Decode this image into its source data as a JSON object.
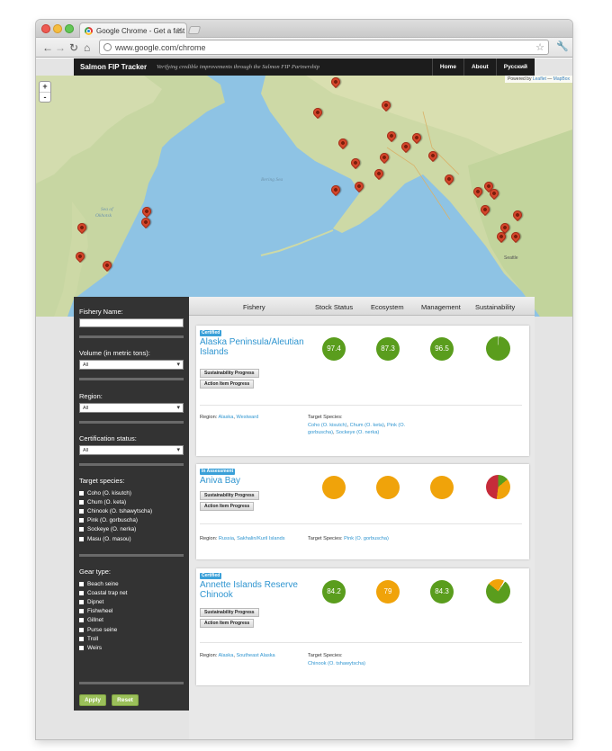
{
  "browser": {
    "tab_title": "Google Chrome - Get a fast",
    "url": "www.google.com/chrome"
  },
  "site": {
    "brand": "Salmon FIP Tracker",
    "tagline": "Verifying credible improvements through the Salmon FIP Partnership",
    "nav": [
      "Home",
      "About",
      "Русский"
    ]
  },
  "map": {
    "labels": {
      "bering_sea": "Bering Sea",
      "sea_okhotsk_1": "Sea of",
      "sea_okhotsk_2": "Okhotsk",
      "seattle": "Seattle"
    },
    "zoom_in": "+",
    "zoom_out": "-",
    "attribution_prefix": "Powered by",
    "attribution_leaflet": "Leaflet",
    "attribution_sep": "—",
    "attribution_mapbox": "MapBox"
  },
  "sidebar": {
    "fishery_name_label": "Fishery Name:",
    "volume_label": "Volume (in metric tons):",
    "volume_value": "All",
    "region_label": "Region:",
    "region_value": "All",
    "cert_label": "Certification status:",
    "cert_value": "All",
    "species_label": "Target species:",
    "species": [
      "Coho (O. kisutch)",
      "Chum (O. keta)",
      "Chinook (O. tshawytscha)",
      "Pink (O. gorbuscha)",
      "Sockeye (O. nerka)",
      "Masu (O. masou)"
    ],
    "gear_label": "Gear type:",
    "gear": [
      "Beach seine",
      "Coastal trap net",
      "Dipnet",
      "Fishwheel",
      "Gillnet",
      "Purse seine",
      "Troll",
      "Weirs"
    ],
    "apply": "Apply",
    "reset": "Reset"
  },
  "results": {
    "headers": [
      "Fishery",
      "Stock Status",
      "Ecosystem",
      "Management",
      "Sustainability"
    ],
    "sustainability_btn": "Sustainability Progress",
    "action_btn": "Action Item Progress",
    "region_prefix": "Region:",
    "species_prefix": "Target Species:",
    "cards": [
      {
        "badge": "Certified",
        "title": "Alaska Peninsula/Aleutian Islands",
        "stock": "97.4",
        "ecosystem": "87.3",
        "management": "96.5",
        "stock_color": "green",
        "ecosystem_color": "green",
        "management_color": "green",
        "region_links": [
          "Alaska",
          "Westward"
        ],
        "species_links": [
          "Coho (O. kisutch)",
          "Chum (O. keta)",
          "Pink (O. gorbuscha)",
          "Sockeye (O. nerka)"
        ]
      },
      {
        "badge": "In Assessment",
        "title": "Aniva Bay",
        "stock": "",
        "ecosystem": "",
        "management": "",
        "stock_color": "orange",
        "ecosystem_color": "orange",
        "management_color": "orange",
        "region_links": [
          "Russia",
          "Sakhalin/Kuril Islands"
        ],
        "species_links": [
          "Pink (O. gorbuscha)"
        ]
      },
      {
        "badge": "Certified",
        "title": "Annette Islands Reserve Chinook",
        "stock": "84.2",
        "ecosystem": "79",
        "management": "84.3",
        "stock_color": "green",
        "ecosystem_color": "orange",
        "management_color": "green",
        "region_links": [
          "Alaska",
          "Southeast Alaska"
        ],
        "species_links": [
          "Chinook (O. tshawytscha)"
        ]
      }
    ]
  },
  "colors": {
    "green": "#5a9d1d",
    "orange": "#f0a30a",
    "red": "#c62b3a",
    "link": "#2f95d0",
    "sidebar": "#333333",
    "pin": "#d5462b"
  }
}
